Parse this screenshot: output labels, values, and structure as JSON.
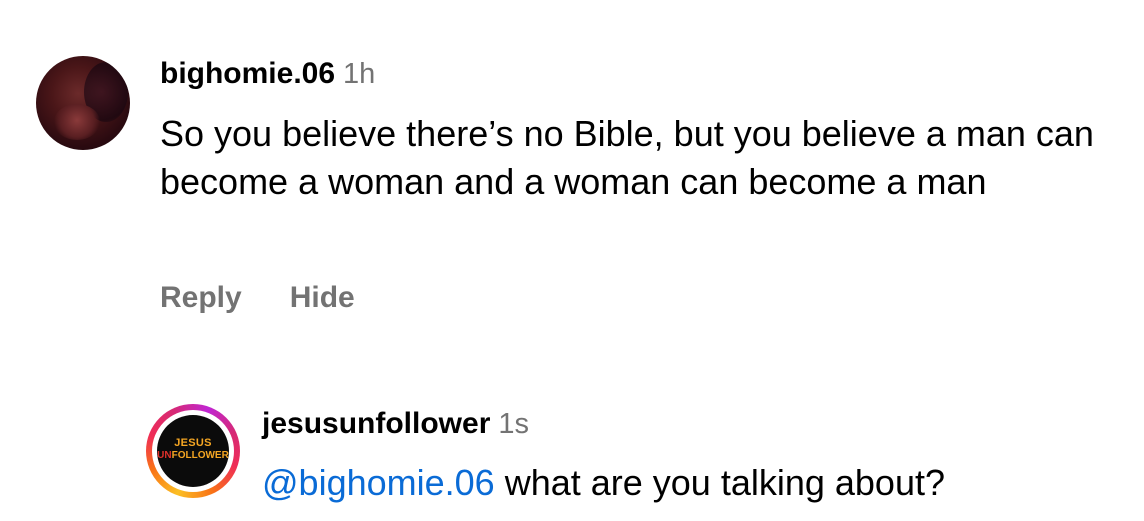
{
  "comments": [
    {
      "username": "bighomie.06",
      "time": "1h",
      "text": "So you believe there’s no Bible, but you believe a man can become a woman and a woman can become a man",
      "actions": {
        "reply": "Reply",
        "hide": "Hide"
      }
    },
    {
      "username": "jesusunfollower",
      "time": "1s",
      "mention": "@bighomie.06",
      "text": " what are you talking about?",
      "avatar_logo": {
        "line1": "JESUS",
        "line2_prefix": "UN",
        "line2_suffix": "FOLLOWER"
      }
    }
  ],
  "colors": {
    "username": "#000000",
    "secondary_text": "#737373",
    "mention": "#0a6bd6",
    "logo_gold": "#f5a623",
    "logo_red": "#e0312b"
  }
}
